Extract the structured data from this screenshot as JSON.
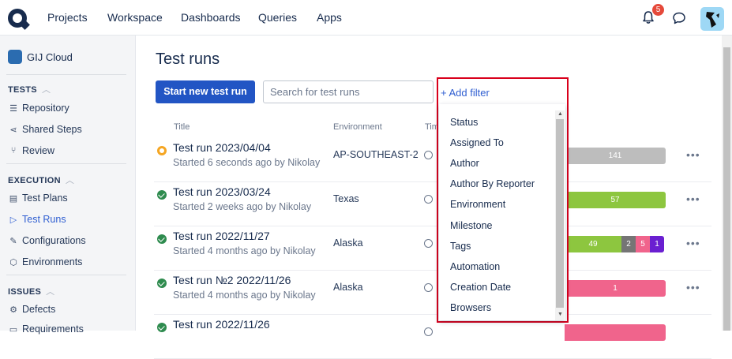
{
  "nav": {
    "items": [
      "Projects",
      "Workspace",
      "Dashboards",
      "Queries",
      "Apps"
    ],
    "notification_count": "5"
  },
  "sidebar": {
    "workspace": "GIJ Cloud",
    "sections": [
      {
        "heading": "TESTS",
        "items": [
          "Repository",
          "Shared Steps",
          "Review"
        ]
      },
      {
        "heading": "EXECUTION",
        "items": [
          "Test Plans",
          "Test Runs",
          "Configurations",
          "Environments"
        ]
      },
      {
        "heading": "ISSUES",
        "items": [
          "Defects",
          "Requirements"
        ]
      }
    ],
    "active_item": "Test Runs"
  },
  "main": {
    "title": "Test runs",
    "start_button": "Start new test run",
    "search_placeholder": "Search for test runs",
    "add_filter": "+ Add filter",
    "columns": [
      "Title",
      "Environment",
      "Tim"
    ]
  },
  "runs": [
    {
      "title": "Test run 2023/04/04",
      "sub": "Started 6 seconds ago by Nikolay",
      "env": "AP-SOUTHEAST-2",
      "status": "running",
      "segments": [
        {
          "label": "141",
          "color": "#bdbdbd"
        }
      ]
    },
    {
      "title": "Test run 2023/03/24",
      "sub": "Started 2 weeks ago by Nikolay",
      "env": "Texas",
      "status": "passed",
      "segments": [
        {
          "label": "57",
          "color": "#8dc63f"
        }
      ]
    },
    {
      "title": "Test run 2022/11/27",
      "sub": "Started 4 months ago by Nikolay",
      "env": "Alaska",
      "status": "passed",
      "segments": [
        {
          "label": "49",
          "color": "#8dc63f"
        },
        {
          "label": "2",
          "color": "#757575"
        },
        {
          "label": "5",
          "color": "#f0648c"
        },
        {
          "label": "1",
          "color": "#6a1fd1"
        }
      ]
    },
    {
      "title": "Test run №2 2022/11/26",
      "sub": "Started 4 months ago by Nikolay",
      "env": "Alaska",
      "status": "passed",
      "segments": [
        {
          "label": "1",
          "color": "#f0648c"
        }
      ]
    },
    {
      "title": "Test run 2022/11/26",
      "sub": "",
      "env": "",
      "status": "passed",
      "segments": [
        {
          "label": "",
          "color": "#f0648c"
        }
      ]
    }
  ],
  "filter_menu": {
    "items": [
      "Status",
      "Assigned To",
      "Author",
      "Author By Reporter",
      "Environment",
      "Milestone",
      "Tags",
      "Automation",
      "Creation Date",
      "Browsers"
    ]
  },
  "colors": {
    "primary": "#2255c4",
    "highlight_border": "#d9001b",
    "passed": "#2e8b4e",
    "running": "#f5a623"
  }
}
